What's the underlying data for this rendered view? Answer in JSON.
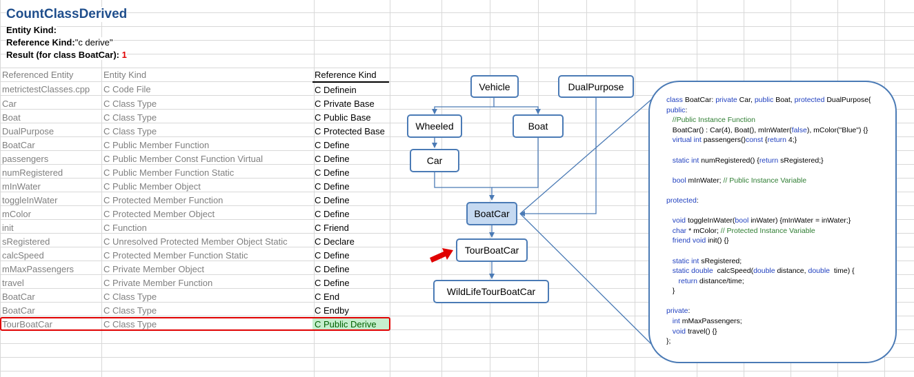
{
  "header": {
    "title": "CountClassDerived",
    "entity_kind_label": "Entity Kind:",
    "entity_kind_value": "",
    "reference_kind_label": "Reference Kind:",
    "reference_kind_value": "\"c derive\"",
    "result_label": "Result  (for class BoatCar):",
    "result_value": "1"
  },
  "table": {
    "headers": [
      "Referenced Entity",
      "Entity Kind",
      "Reference Kind"
    ],
    "rows": [
      [
        "metrictestClasses.cpp",
        "C Code File",
        "C Definein"
      ],
      [
        "Car",
        "C Class Type",
        "C Private Base"
      ],
      [
        "Boat",
        "C Class Type",
        "C Public Base"
      ],
      [
        "DualPurpose",
        "C Class Type",
        "C Protected Base"
      ],
      [
        "BoatCar",
        "C Public Member Function",
        "C Define"
      ],
      [
        "passengers",
        "C Public Member Const Function Virtual",
        "C Define"
      ],
      [
        "numRegistered",
        "C Public Member Function Static",
        "C Define"
      ],
      [
        "mInWater",
        "C Public Member Object",
        "C Define"
      ],
      [
        "toggleInWater",
        "C Protected Member Function",
        "C Define"
      ],
      [
        "mColor",
        "C Protected Member Object",
        "C Define"
      ],
      [
        "init",
        "C Function",
        "C Friend"
      ],
      [
        "sRegistered",
        "C Unresolved Protected Member Object Static",
        "C Declare"
      ],
      [
        "calcSpeed",
        "C Protected Member Function Static",
        "C Define"
      ],
      [
        "mMaxPassengers",
        "C Private Member Object",
        "C Define"
      ],
      [
        "travel",
        "C Private Member Function",
        "C Define"
      ],
      [
        "BoatCar",
        "C Class Type",
        "C End"
      ],
      [
        "BoatCar",
        "C Class Type",
        "C Endby"
      ],
      [
        "TourBoatCar",
        "C Class Type",
        "C Public Derive"
      ]
    ],
    "highlighted_row": 17
  },
  "diagram": {
    "nodes": {
      "vehicle": "Vehicle",
      "dualpurpose": "DualPurpose",
      "wheeled": "Wheeled",
      "boat": "Boat",
      "car": "Car",
      "boatcar": "BoatCar",
      "tourboatcar": "TourBoatCar",
      "wildlife": "WildLifeTourBoatCar"
    },
    "selected_node": "BoatCar"
  },
  "code": {
    "lines": [
      [
        [
          "kw",
          "class "
        ],
        [
          "t",
          "BoatCar: "
        ],
        [
          "kw",
          "private "
        ],
        [
          "t",
          "Car, "
        ],
        [
          "kw",
          "public "
        ],
        [
          "t",
          "Boat, "
        ],
        [
          "kw",
          "protected "
        ],
        [
          "t",
          "DualPurpose{"
        ]
      ],
      [
        [
          "kw",
          "public"
        ],
        [
          "t",
          ":"
        ]
      ],
      [
        [
          "cm",
          "   //Public Instance Function"
        ]
      ],
      [
        [
          "t",
          "   BoatCar() : Car(4), Boat(), mInWater("
        ],
        [
          "kw",
          "false"
        ],
        [
          "t",
          "), mColor(\"Blue\") {}"
        ]
      ],
      [
        [
          "kw",
          "   virtual int "
        ],
        [
          "t",
          "passengers()"
        ],
        [
          "kw",
          "const "
        ],
        [
          "t",
          "{"
        ],
        [
          "kw",
          "return "
        ],
        [
          "t",
          "4;}"
        ]
      ],
      [
        [
          "t",
          ""
        ]
      ],
      [
        [
          "kw",
          "   static int "
        ],
        [
          "t",
          "numRegistered() {"
        ],
        [
          "kw",
          "return "
        ],
        [
          "t",
          "sRegistered;}"
        ]
      ],
      [
        [
          "t",
          ""
        ]
      ],
      [
        [
          "kw",
          "   bool "
        ],
        [
          "t",
          "mInWater; "
        ],
        [
          "cm",
          "// Public Instance Variable"
        ]
      ],
      [
        [
          "t",
          ""
        ]
      ],
      [
        [
          "kw",
          "protected"
        ],
        [
          "t",
          ":"
        ]
      ],
      [
        [
          "t",
          ""
        ]
      ],
      [
        [
          "kw",
          "   void "
        ],
        [
          "t",
          "toggleInWater("
        ],
        [
          "kw",
          "bool "
        ],
        [
          "t",
          "inWater) {mInWater = inWater;}"
        ]
      ],
      [
        [
          "kw",
          "   char "
        ],
        [
          "t",
          "* mColor; "
        ],
        [
          "cm",
          "// Protected Instance Variable"
        ]
      ],
      [
        [
          "kw",
          "   friend void "
        ],
        [
          "t",
          "init() {}"
        ]
      ],
      [
        [
          "t",
          ""
        ]
      ],
      [
        [
          "kw",
          "   static int "
        ],
        [
          "t",
          "sRegistered;"
        ]
      ],
      [
        [
          "kw",
          "   static double  "
        ],
        [
          "t",
          "calcSpeed("
        ],
        [
          "kw",
          "double "
        ],
        [
          "t",
          "distance, "
        ],
        [
          "kw",
          "double  "
        ],
        [
          "t",
          "time) {"
        ]
      ],
      [
        [
          "kw",
          "      return "
        ],
        [
          "t",
          "distance/time;"
        ]
      ],
      [
        [
          "t",
          "   }"
        ]
      ],
      [
        [
          "t",
          ""
        ]
      ],
      [
        [
          "kw",
          "private"
        ],
        [
          "t",
          ":"
        ]
      ],
      [
        [
          "kw",
          "   int "
        ],
        [
          "t",
          "mMaxPassengers;"
        ]
      ],
      [
        [
          "kw",
          "   void "
        ],
        [
          "t",
          "travel() {}"
        ]
      ],
      [
        [
          "t",
          "};"
        ]
      ]
    ]
  },
  "colors": {
    "title": "#1f4e8c",
    "node_border": "#4a7ab5",
    "selected_node_fill": "#c5d9f1",
    "highlight_border": "#e00000",
    "highlight_fill": "#c6efce",
    "arrow": "#e00000"
  }
}
